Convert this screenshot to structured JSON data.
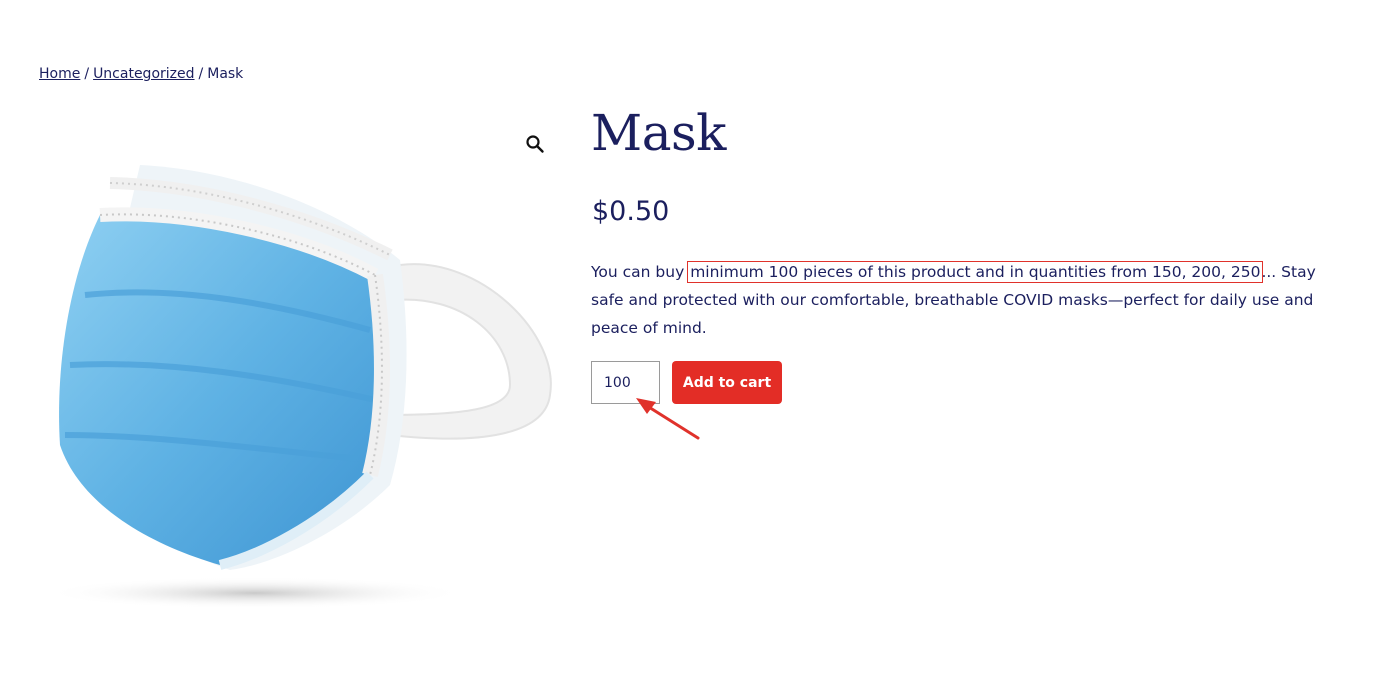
{
  "breadcrumb": {
    "home": "Home",
    "separator1": "/",
    "category": "Uncategorized",
    "separator2": "/",
    "current": "Mask"
  },
  "product": {
    "title": "Mask",
    "price": "$0.50",
    "description": {
      "before": "You can buy ",
      "highlight": "minimum 100 pieces of this product and in quantities from 150, 200, 250",
      "after": "... Stay safe and protected with our comfortable, breathable COVID masks—perfect for daily use and peace of mind."
    },
    "image_alt": "Blue surgical face mask"
  },
  "cart": {
    "quantity_value": "100",
    "add_label": "Add to cart"
  },
  "icons": {
    "zoom": "magnifier-icon"
  },
  "colors": {
    "text": "#1b1f5e",
    "accent": "#e32d26",
    "highlight_border": "#e0322b",
    "mask_blue": "#6bb8e6"
  }
}
